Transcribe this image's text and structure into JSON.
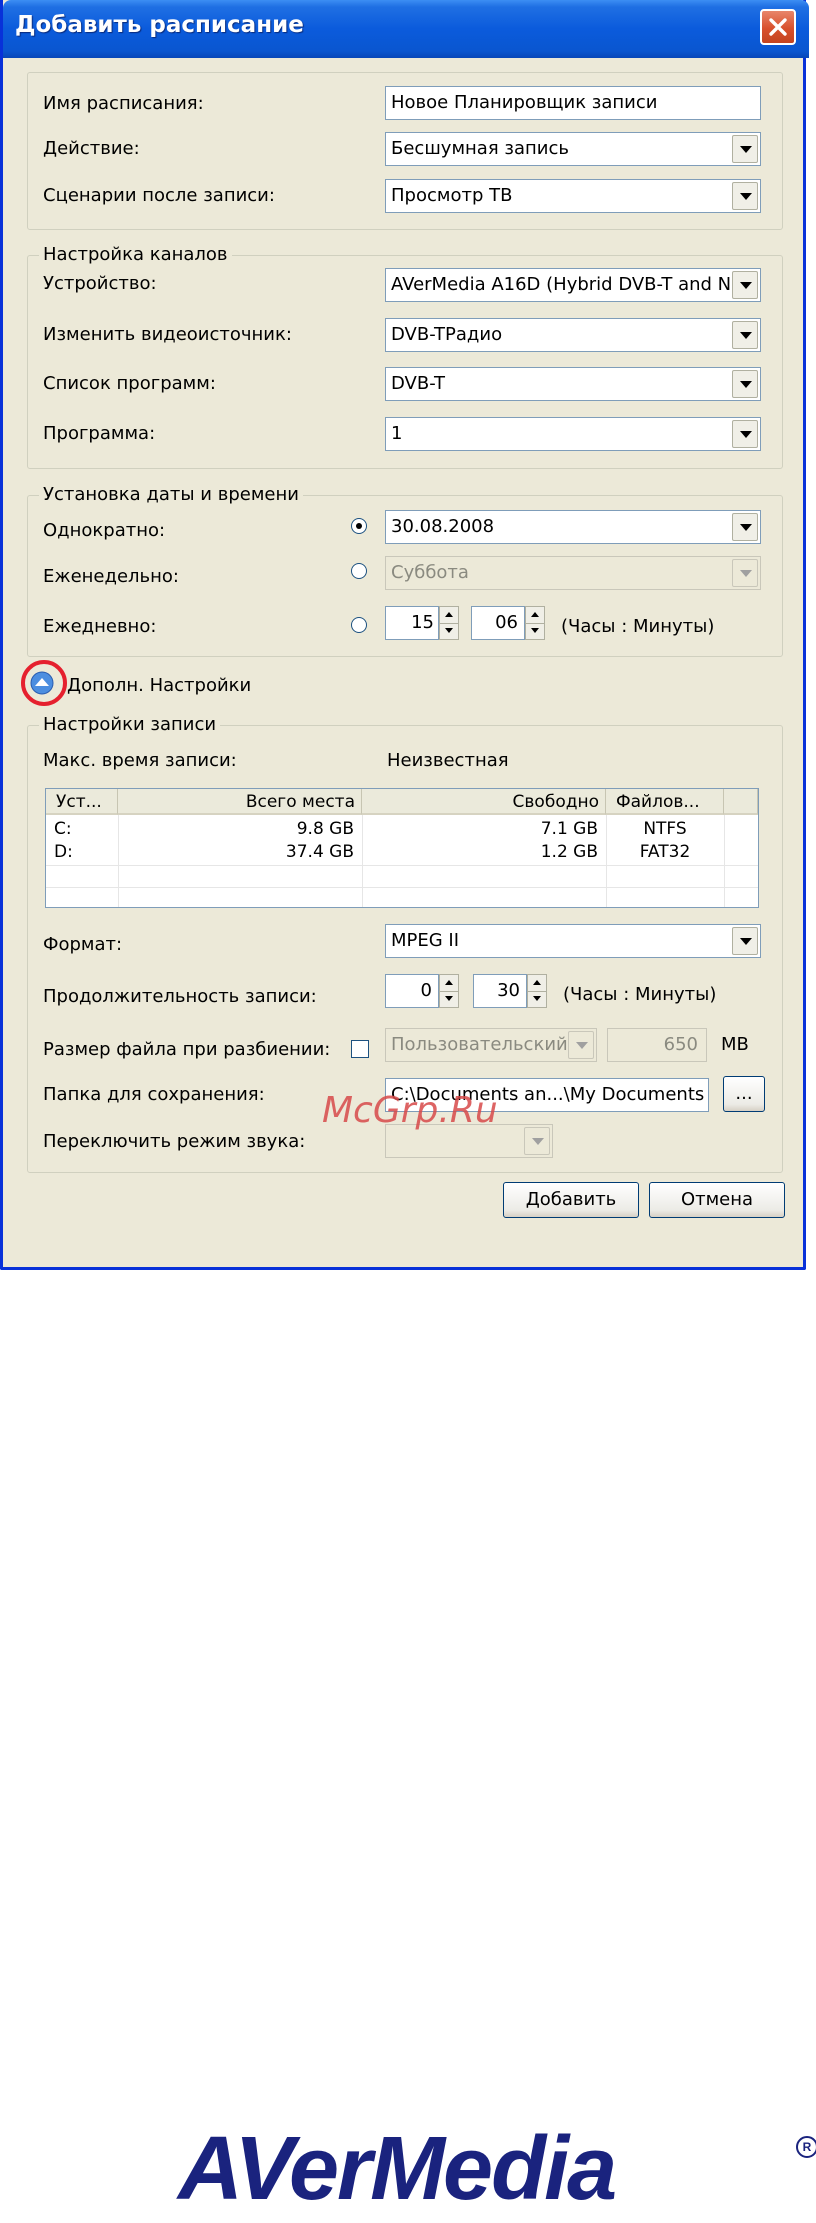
{
  "window": {
    "title": "Добавить расписание"
  },
  "schedule": {
    "name_label": "Имя расписания:",
    "name_value": "Новое Планировщик записи",
    "action_label": "Действие:",
    "action_value": "Бесшумная запись",
    "after_label": "Сценарии после записи:",
    "after_value": "Просмотр ТВ"
  },
  "channels": {
    "legend": "Настройка каналов",
    "device_label": "Устройство:",
    "device_value": "AVerMedia A16D (Hybrid DVB-T and N",
    "source_label": "Изменить видеоисточник:",
    "source_value": "DVB-TРадио",
    "list_label": "Список программ:",
    "list_value": "DVB-T",
    "program_label": "Программа:",
    "program_value": "1"
  },
  "datetime": {
    "legend": "Установка даты и времени",
    "once_label": "Однократно:",
    "once_value": "30.08.2008",
    "weekly_label": "Еженедельно:",
    "weekly_value": "Суббота",
    "daily_label": "Ежедневно:",
    "daily_hours": "15",
    "daily_minutes": "06",
    "daily_hint": "(Часы : Минуты)"
  },
  "advanced": {
    "toggle_label": "Дополн. Настройки"
  },
  "record": {
    "legend": "Настройки записи",
    "max_time_label": "Макс. время записи:",
    "max_time_value": "Неизвестная",
    "table": {
      "headers": [
        "Уст...",
        "Всего места",
        "Свободно",
        "Файлов..."
      ],
      "rows": [
        [
          "C:",
          "9.8 GB",
          "7.1 GB",
          "NTFS"
        ],
        [
          "D:",
          "37.4 GB",
          "1.2 GB",
          "FAT32"
        ]
      ]
    },
    "format_label": "Формат:",
    "format_value": "MPEG II",
    "duration_label": "Продолжительность записи:",
    "duration_hours": "0",
    "duration_minutes": "30",
    "duration_hint": "(Часы : Минуты)",
    "split_label": "Размер файла при разбиении:",
    "split_mode": "Пользовательский",
    "split_size": "650",
    "split_unit": "MB",
    "folder_label": "Папка для сохранения:",
    "folder_value": "C:\\Documents an...\\My Documents",
    "browse_label": "...",
    "audio_label": "Переключить режим звука:",
    "audio_value": ""
  },
  "buttons": {
    "add": "Добавить",
    "cancel": "Отмена"
  },
  "watermark": "McGrp.Ru",
  "footer": {
    "brand": "AVerMedia",
    "reg": "R"
  },
  "colors": {
    "titlebar": "#0b5bdc",
    "face": "#ece9d8",
    "highlight_ring": "#e5202e",
    "brand": "#1a237e"
  }
}
